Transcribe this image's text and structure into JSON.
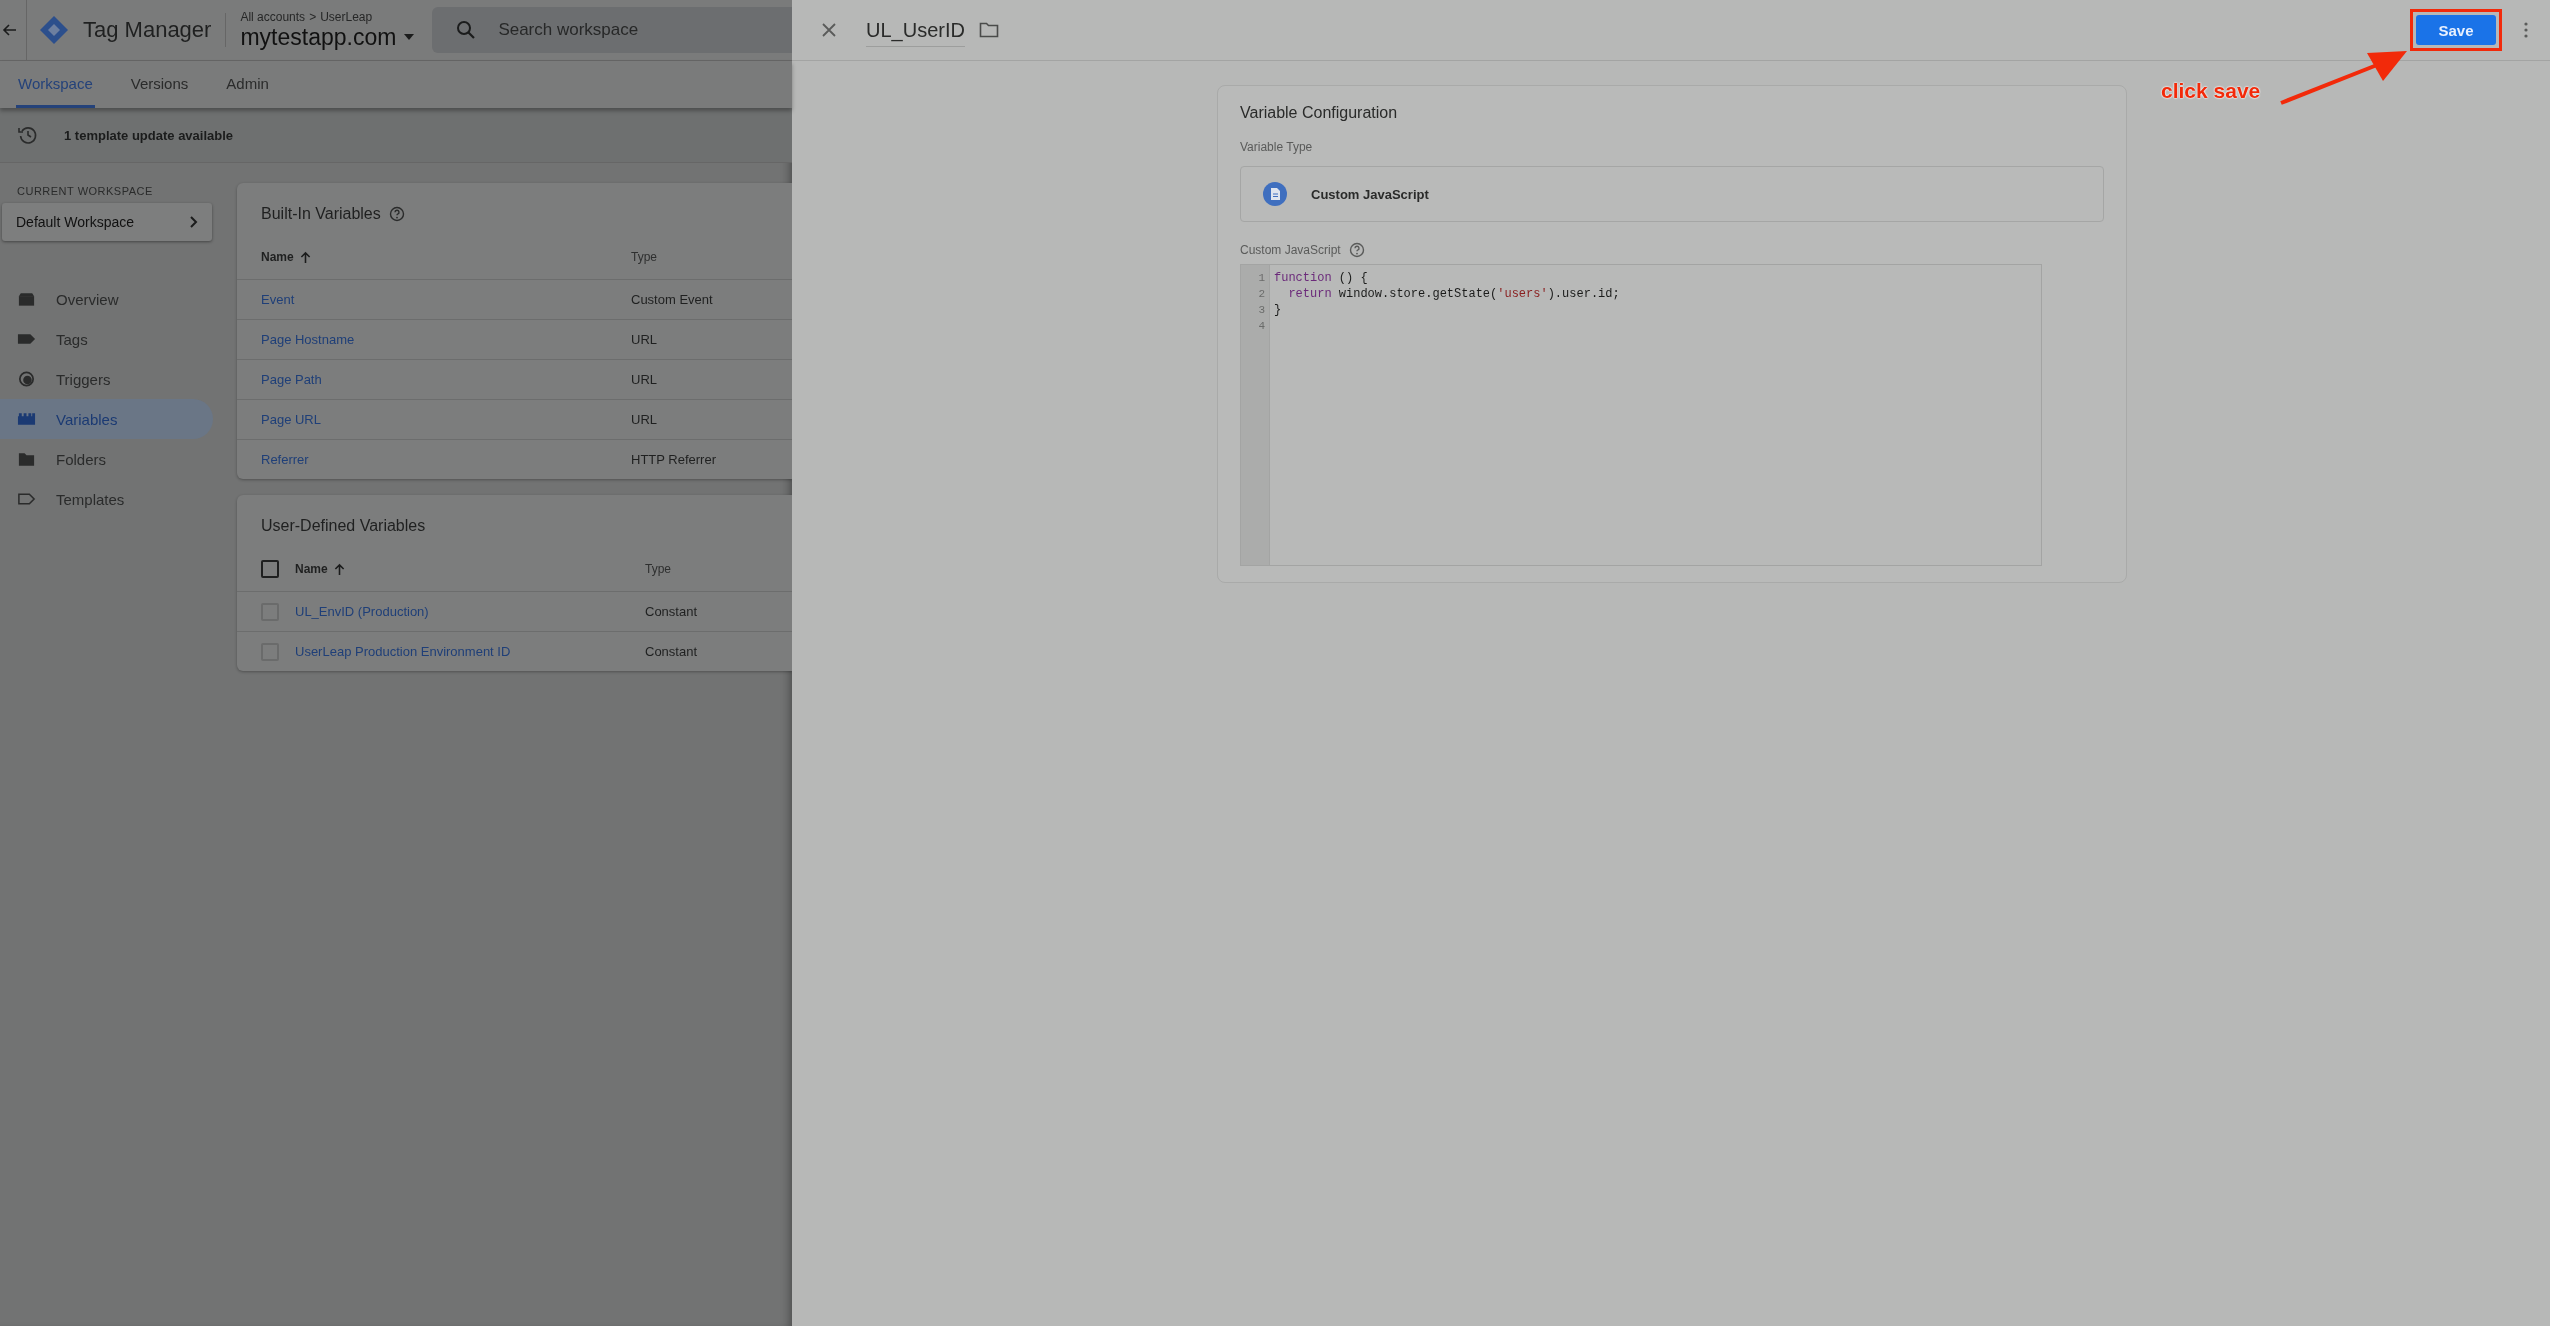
{
  "header": {
    "app_name": "Tag Manager",
    "breadcrumb": {
      "account": "All accounts",
      "separator": ">",
      "container": "UserLeap"
    },
    "container_name": "mytestapp.com",
    "search": {
      "placeholder": "Search workspace"
    }
  },
  "tabs": [
    {
      "label": "Workspace",
      "selected": true
    },
    {
      "label": "Versions",
      "selected": false
    },
    {
      "label": "Admin",
      "selected": false
    }
  ],
  "notice": {
    "text": "1 template update available"
  },
  "sidebar": {
    "section_label": "CURRENT WORKSPACE",
    "workspace": "Default Workspace",
    "items": [
      {
        "label": "Overview",
        "kind": "overview",
        "selected": false
      },
      {
        "label": "Tags",
        "kind": "tag",
        "selected": false
      },
      {
        "label": "Triggers",
        "kind": "trigger",
        "selected": false
      },
      {
        "label": "Variables",
        "kind": "variables",
        "selected": true
      },
      {
        "label": "Folders",
        "kind": "folder",
        "selected": false
      },
      {
        "label": "Templates",
        "kind": "template",
        "selected": false
      }
    ]
  },
  "built_in": {
    "title": "Built-In Variables",
    "columns": [
      "Name",
      "Type"
    ],
    "rows": [
      {
        "name": "Event",
        "type": "Custom Event"
      },
      {
        "name": "Page Hostname",
        "type": "URL"
      },
      {
        "name": "Page Path",
        "type": "URL"
      },
      {
        "name": "Page URL",
        "type": "URL"
      },
      {
        "name": "Referrer",
        "type": "HTTP Referrer"
      }
    ]
  },
  "user_defined": {
    "title": "User-Defined Variables",
    "columns": [
      "Name",
      "Type"
    ],
    "all_checked": false,
    "rows": [
      {
        "name": "UL_EnvID (Production)",
        "type": "Constant",
        "checked": false
      },
      {
        "name": "UserLeap Production Environment ID",
        "type": "Constant",
        "checked": false
      }
    ]
  },
  "panel": {
    "title": "UL_UserID",
    "save": "Save",
    "card_title": "Variable Configuration",
    "type_label": "Variable Type",
    "type_value": "Custom JavaScript",
    "code_label": "Custom JavaScript",
    "code": [
      {
        "number": "1",
        "tokens": [
          {
            "kind": "keyword",
            "text": "function"
          },
          {
            "kind": "plain",
            "text": " () {"
          }
        ]
      },
      {
        "number": "2",
        "indent": true,
        "tokens": [
          {
            "kind": "keyword",
            "text": "return"
          },
          {
            "kind": "plain",
            "text": " window.store.getState("
          },
          {
            "kind": "string",
            "text": "'users'"
          },
          {
            "kind": "plain",
            "text": ").user.id;"
          }
        ]
      },
      {
        "number": "3",
        "tokens": [
          {
            "kind": "plain",
            "text": "}"
          }
        ]
      },
      {
        "number": "4"
      }
    ]
  },
  "annotation": {
    "text": "click save"
  }
}
